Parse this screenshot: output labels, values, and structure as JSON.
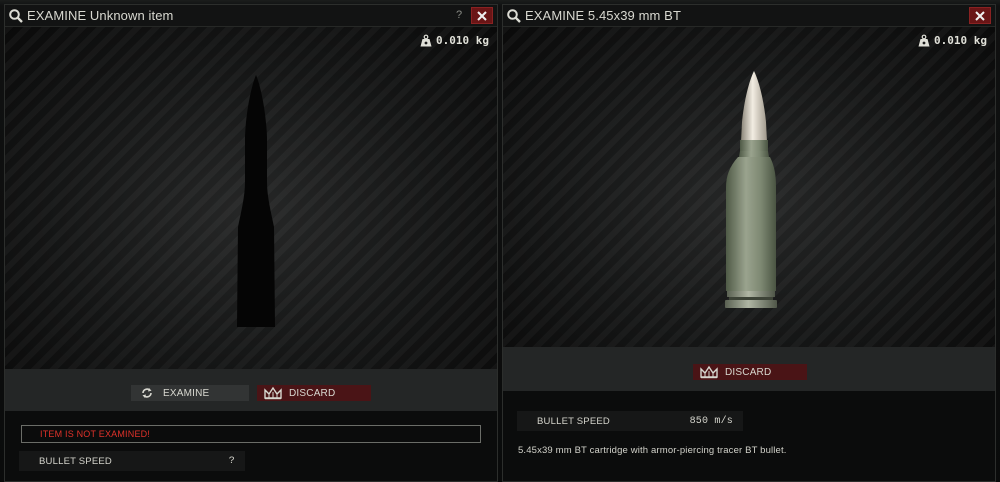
{
  "left_window": {
    "title": "EXAMINE Unknown item",
    "help_label": "?",
    "weight": "0.010 kg",
    "examine_label": "EXAMINE",
    "discard_label": "DISCARD",
    "warning": "ITEM IS NOT EXAMINED!",
    "stat": {
      "label": "BULLET SPEED",
      "value": "?"
    }
  },
  "right_window": {
    "title": "EXAMINE 5.45x39 mm BT",
    "weight": "0.010 kg",
    "discard_label": "DISCARD",
    "stat": {
      "label": "BULLET SPEED",
      "value": "850 m/s"
    },
    "description": "5.45x39 mm BT cartridge with armor-piercing tracer BT bullet."
  },
  "icons": {
    "title": "magnifier-icon",
    "close": "close-x-icon",
    "weight": "weight-icon",
    "examine": "refresh-icon",
    "discard": "crown-discard-icon"
  },
  "colors": {
    "close_red": "#6a1516",
    "discard_red": "#4a1416",
    "warning_red": "#e0322a"
  }
}
